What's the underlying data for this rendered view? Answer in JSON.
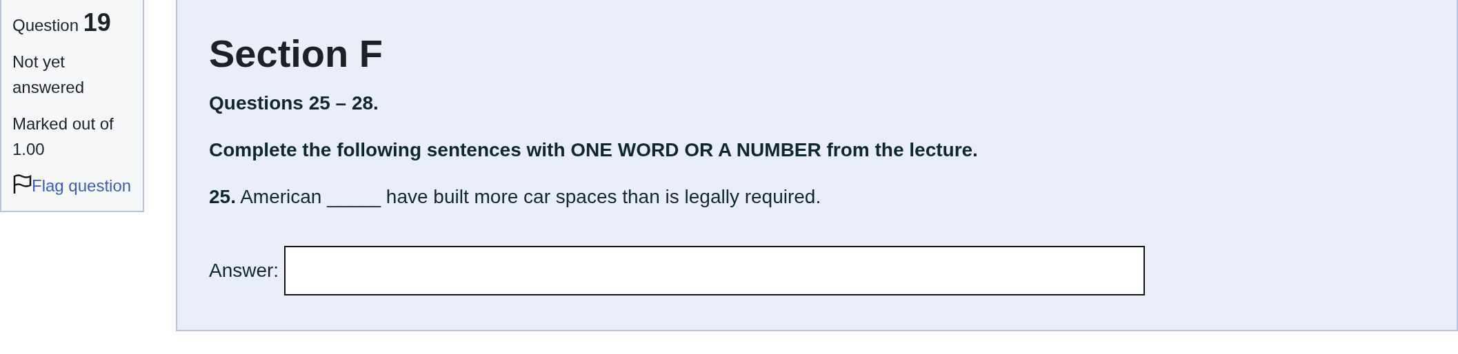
{
  "info": {
    "label": "Question",
    "number": "19",
    "state": "Not yet answered",
    "grade": "Marked out of 1.00",
    "flag_link": "Flag question"
  },
  "content": {
    "heading": "Section F",
    "subheading": "Questions 25 – 28.",
    "instructions": "Complete the following sentences with ONE WORD OR A NUMBER from the lecture.",
    "question": "**25.** American _____ have built more car spaces than is legally required.",
    "answer_label": "Answer:"
  }
}
